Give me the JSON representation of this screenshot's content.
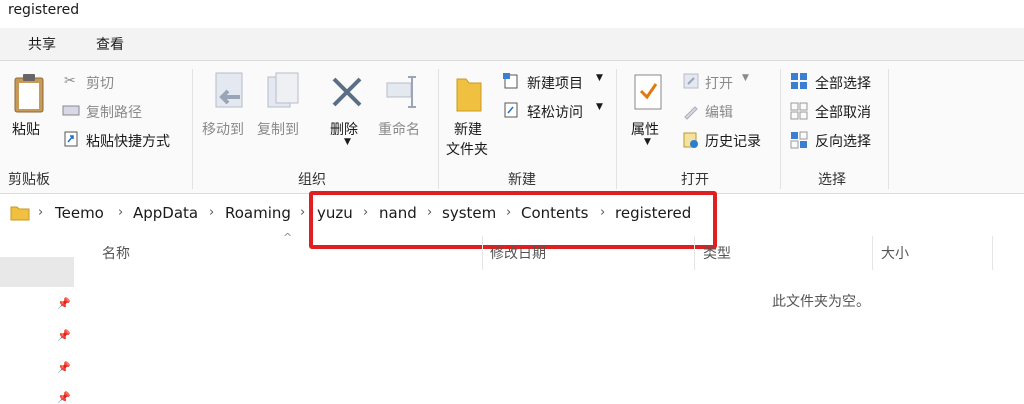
{
  "window": {
    "title": "registered"
  },
  "tabs": [
    {
      "label": "共享"
    },
    {
      "label": "查看"
    }
  ],
  "ribbon": {
    "clipboard": {
      "paste": "粘贴",
      "cut": "剪切",
      "copy_path": "复制路径",
      "paste_shortcut": "粘贴快捷方式",
      "group": "剪贴板"
    },
    "organize": {
      "move_to": "移动到",
      "copy_to": "复制到",
      "delete": "删除",
      "rename": "重命名",
      "group": "组织"
    },
    "new": {
      "new_folder_line1": "新建",
      "new_folder_line2": "文件夹",
      "new_item": "新建项目",
      "easy_access": "轻松访问",
      "group": "新建"
    },
    "open": {
      "properties": "属性",
      "open": "打开",
      "edit": "编辑",
      "history": "历史记录",
      "group": "打开"
    },
    "select": {
      "select_all": "全部选择",
      "select_none": "全部取消",
      "invert": "反向选择",
      "group": "选择"
    }
  },
  "address": {
    "crumbs": [
      "Teemo",
      "AppData",
      "Roaming",
      "yuzu",
      "nand",
      "system",
      "Contents",
      "registered"
    ]
  },
  "columns": {
    "name": "名称",
    "modified": "修改日期",
    "type": "类型",
    "size": "大小"
  },
  "main": {
    "empty_message": "此文件夹为空。"
  },
  "colors": {
    "highlight": "#e02020",
    "folder": "#f0c040"
  }
}
